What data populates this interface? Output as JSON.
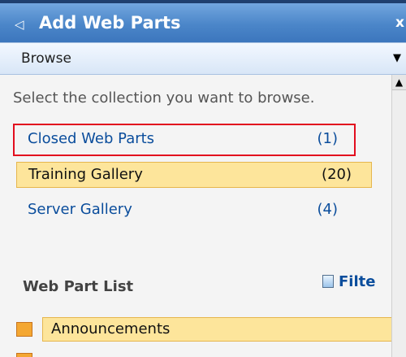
{
  "panel": {
    "title": "Add Web Parts",
    "collapse_glyph": "◁",
    "close_glyph": "x"
  },
  "dropdown": {
    "selected": "Browse",
    "arrow_glyph": "▼"
  },
  "content": {
    "instruction": "Select the collection you want to browse.",
    "collections": [
      {
        "name": "Closed Web Parts",
        "count": "(1)"
      },
      {
        "name": "Training Gallery",
        "count": "(20)"
      },
      {
        "name": "Server Gallery",
        "count": "(4)"
      }
    ],
    "section_title": "Web Part List",
    "filter_label": "Filte",
    "web_parts": [
      {
        "name": "Announcements",
        "icon": "announcements-icon"
      },
      {
        "name": "",
        "icon": "web-part-icon"
      }
    ]
  },
  "scrollbar": {
    "up_glyph": "▲"
  },
  "colors": {
    "title_bar": "#4b86c9",
    "link": "#0a4d9c",
    "selection": "#fde59b",
    "highlight_box": "#e20d1e"
  }
}
